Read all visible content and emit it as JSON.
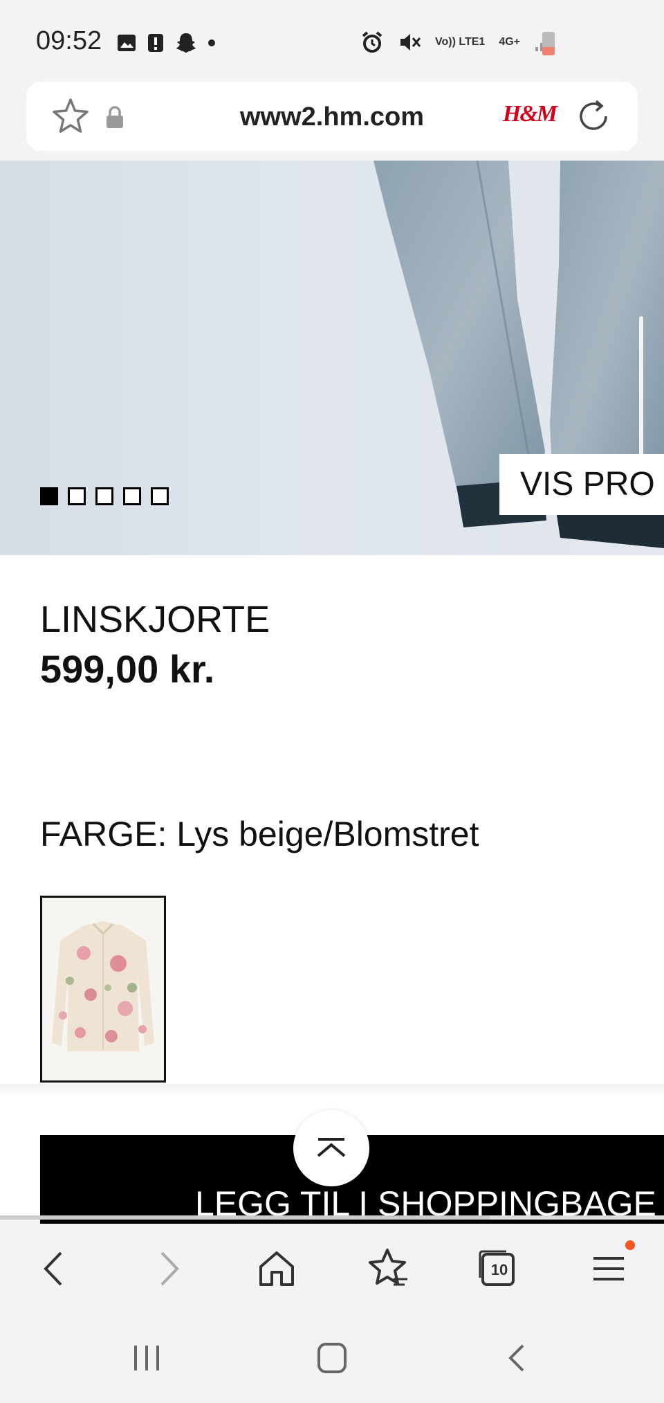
{
  "status_bar": {
    "time": "09:52",
    "network_label": "Vo)) LTE1",
    "network_type": "4G+",
    "battery_level": 0.35
  },
  "browser": {
    "url": "www2.hm.com",
    "site_logo_text": "H&M"
  },
  "hero": {
    "image_count": 5,
    "active_index": 0,
    "view_button_label": "VIS PRO"
  },
  "product": {
    "title": "LINSKJORTE",
    "price": "599,00 kr.",
    "color_label": "FARGE: Lys beige/Blomstret"
  },
  "actions": {
    "add_to_bag_label": "LEGG TIL I SHOPPINGBAGE"
  },
  "toolbar": {
    "tab_count": "10",
    "menu_has_notification": true
  },
  "colors": {
    "brand": "#d4001a",
    "notification": "#f0561e"
  }
}
